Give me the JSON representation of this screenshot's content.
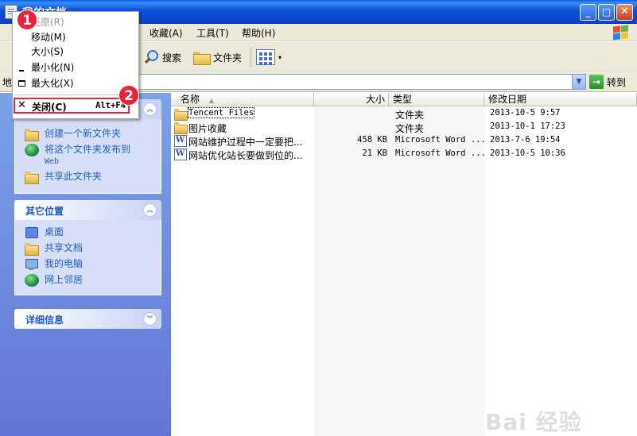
{
  "window": {
    "title": "我的文档",
    "buttons": {
      "minimize": "_",
      "maximize": "□",
      "close": "✕"
    }
  },
  "menubar": {
    "items": [
      "收藏(A)",
      "工具(T)",
      "帮助(H)"
    ]
  },
  "toolbar": {
    "search_label": "搜索",
    "folders_label": "文件夹",
    "views_caret": "▾"
  },
  "addressbar": {
    "label": "地",
    "value": "",
    "dropdown_glyph": "▼",
    "go_label": "转到",
    "go_glyph": "→"
  },
  "file_tasks": {
    "items": [
      {
        "label": "创建一个新文件夹",
        "icon": "new-folder-icon"
      },
      {
        "label": "将这个文件夹发布到",
        "sublabel": "Web",
        "icon": "publish-globe-icon"
      },
      {
        "label": "共享此文件夹",
        "icon": "share-folder-icon"
      }
    ]
  },
  "other_places": {
    "title": "其它位置",
    "items": [
      {
        "label": "桌面",
        "icon": "desktop-icon"
      },
      {
        "label": "共享文档",
        "icon": "shared-folder-icon"
      },
      {
        "label": "我的电脑",
        "icon": "my-computer-icon"
      },
      {
        "label": "网上邻居",
        "icon": "network-icon"
      }
    ]
  },
  "details": {
    "title": "详细信息"
  },
  "file_list": {
    "columns": {
      "name": "名称",
      "size": "大小",
      "type": "类型",
      "modified": "修改日期"
    },
    "sort_glyph": "▲",
    "rows": [
      {
        "name": "Tencent Files",
        "size": "",
        "type": "文件夹",
        "modified": "2013-10-5 9:57",
        "icon": "folder-icon"
      },
      {
        "name": "图片收藏",
        "size": "",
        "type": "文件夹",
        "modified": "2013-10-1 17:23",
        "icon": "pictures-folder-icon"
      },
      {
        "name": "网站维护过程中一定要把...",
        "size": "458 KB",
        "type": "Microsoft Word ...",
        "modified": "2013-7-6 19:54",
        "icon": "word-doc-icon"
      },
      {
        "name": "网站优化站长要做到位的...",
        "size": "21 KB",
        "type": "Microsoft Word ...",
        "modified": "2013-10-5 10:36",
        "icon": "word-doc-icon"
      }
    ]
  },
  "system_menu": {
    "items": [
      {
        "label": "还原(R)",
        "enabled": false,
        "glyph": ""
      },
      {
        "label": "移动(M)",
        "enabled": true,
        "glyph": ""
      },
      {
        "label": "大小(S)",
        "enabled": true,
        "glyph": ""
      },
      {
        "label": "最小化(N)",
        "enabled": true,
        "glyph": "minimize-glyph"
      },
      {
        "label": "最大化(X)",
        "enabled": true,
        "glyph": "maximize-glyph"
      }
    ],
    "close": {
      "label": "关闭(C)",
      "accelerator": "Alt+F4",
      "glyph": "✕"
    }
  },
  "callouts": [
    "1",
    "2"
  ],
  "watermark": "Bai 经验",
  "colors": {
    "titlebar": "#0a4fd8",
    "task_pane": "#7ba2e7",
    "task_link": "#215dc6",
    "callout_red": "#e8233a"
  }
}
